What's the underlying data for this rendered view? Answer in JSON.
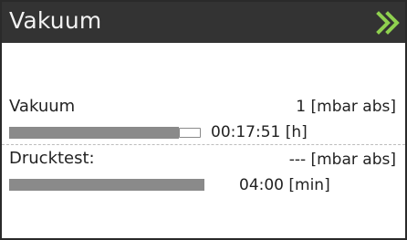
{
  "header": {
    "title": "Vakuum",
    "next_icon": "double-chevron-right-icon",
    "accent": "#8fd14f"
  },
  "vacuum": {
    "label": "Vakuum",
    "value": "1 [mbar abs]",
    "progress": 0.88,
    "time": "00:17:51 [h]"
  },
  "pressure_test": {
    "label": "Drucktest:",
    "value": "--- [mbar abs]",
    "progress": 1.0,
    "time": "04:00 [min]"
  }
}
